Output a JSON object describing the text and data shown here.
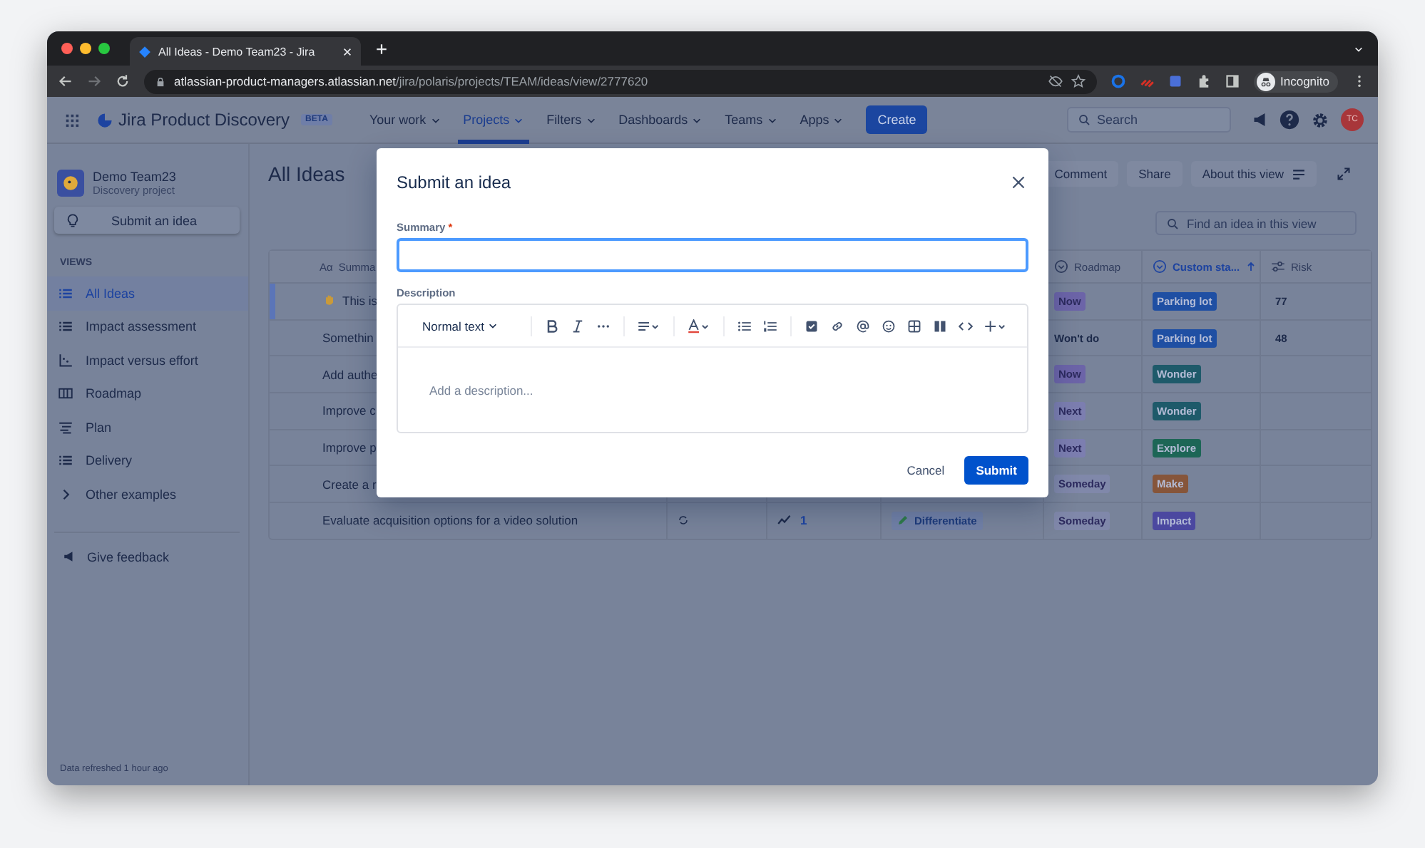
{
  "browser": {
    "tab_title": "All Ideas - Demo Team23 - Jira",
    "url": "**atlassian-product-managers.atlassian.net**/jira/polaris/projects/TEAM/ideas/view/2777620",
    "profile": "Incognito"
  },
  "nav": {
    "product": "Jira Product Discovery",
    "badge": "BETA",
    "items": [
      {
        "label": "Your work",
        "selected": false
      },
      {
        "label": "Projects",
        "selected": true
      },
      {
        "label": "Filters",
        "selected": false
      },
      {
        "label": "Dashboards",
        "selected": false
      },
      {
        "label": "Teams",
        "selected": false
      },
      {
        "label": "Apps",
        "selected": false
      }
    ],
    "create": "Create",
    "search": {
      "placeholder": "Search"
    },
    "avatar": "TC"
  },
  "sidebar": {
    "project": {
      "name": "Demo Team23",
      "type": "Discovery project"
    },
    "submit": "Submit an idea",
    "section": "VIEWS",
    "items": [
      {
        "label": "All Ideas",
        "kind": "list",
        "selected": true
      },
      {
        "label": "Impact assessment",
        "kind": "list",
        "selected": false
      },
      {
        "label": "Impact versus effort",
        "kind": "matrix",
        "selected": false
      },
      {
        "label": "Roadmap",
        "kind": "board",
        "selected": false
      },
      {
        "label": "Plan",
        "kind": "timeline",
        "selected": false
      },
      {
        "label": "Delivery",
        "kind": "list",
        "selected": false
      },
      {
        "label": "Other examples",
        "kind": "folder",
        "selected": false
      }
    ],
    "feedback": "Give feedback",
    "footer": "Data refreshed 1 hour ago"
  },
  "main": {
    "title": "All Ideas",
    "actions": [
      "Comment",
      "Share",
      "About this view"
    ],
    "search": {
      "placeholder": "Find an idea in this view"
    }
  },
  "table": {
    "columns": [
      {
        "label": "Summa",
        "prefix": "Aα",
        "kind": "text",
        "sorted": false
      },
      {
        "label": "Roadmap",
        "kind": "select",
        "sorted": false
      },
      {
        "label": "Custom sta...",
        "kind": "select",
        "sorted": true
      },
      {
        "label": "Risk",
        "kind": "number",
        "sorted": false
      }
    ],
    "rows": [
      {
        "summary": "This is",
        "waving": true,
        "selected": true,
        "roadmap": {
          "label": "Now",
          "kind": "tag",
          "color": "#6c64a8"
        },
        "status": {
          "label": "Parking lot",
          "color": "#1f4fa3"
        },
        "risk": "77"
      },
      {
        "summary": "Somethin",
        "waving": false,
        "selected": false,
        "roadmap": {
          "label": "Won't do",
          "kind": "text"
        },
        "status": {
          "label": "Parking lot",
          "color": "#1f4fa3"
        },
        "risk": "48"
      },
      {
        "summary": "Add authe",
        "waving": false,
        "selected": false,
        "roadmap": {
          "label": "Now",
          "kind": "tag",
          "color": "#6c64a8"
        },
        "status": {
          "label": "Wonder",
          "color": "#1e5a6a"
        }
      },
      {
        "summary": "Improve c",
        "waving": false,
        "selected": false,
        "roadmap": {
          "label": "Next",
          "kind": "tag",
          "color": "#7c7eb0"
        },
        "status": {
          "label": "Wonder",
          "color": "#1e5a6a"
        }
      },
      {
        "summary": "Improve p",
        "waving": false,
        "selected": false,
        "roadmap": {
          "label": "Next",
          "kind": "tag",
          "color": "#7c7eb0"
        },
        "status": {
          "label": "Explore",
          "color": "#1d6656"
        }
      },
      {
        "summary": "Create a r",
        "waving": false,
        "selected": false,
        "roadmap": {
          "label": "Someday",
          "kind": "tag",
          "color": "#8088aa"
        },
        "status": {
          "label": "Make",
          "color": "#86553a"
        }
      },
      {
        "summary": "Evaluate acquisition options for a video solution",
        "waving": false,
        "selected": false,
        "impact": "1",
        "goal": "Differentiate",
        "roadmap": {
          "label": "Someday",
          "kind": "tag",
          "color": "#8088aa"
        },
        "status": {
          "label": "Impact",
          "color": "#4b48a0"
        }
      }
    ]
  },
  "modal": {
    "title": "Submit an idea",
    "summary": {
      "label": "Summary",
      "required_mark": "*",
      "focused": true
    },
    "description": {
      "label": "Description",
      "style": "Normal text",
      "placeholder": "Add a description..."
    },
    "cancel": "Cancel",
    "submit": "Submit"
  }
}
